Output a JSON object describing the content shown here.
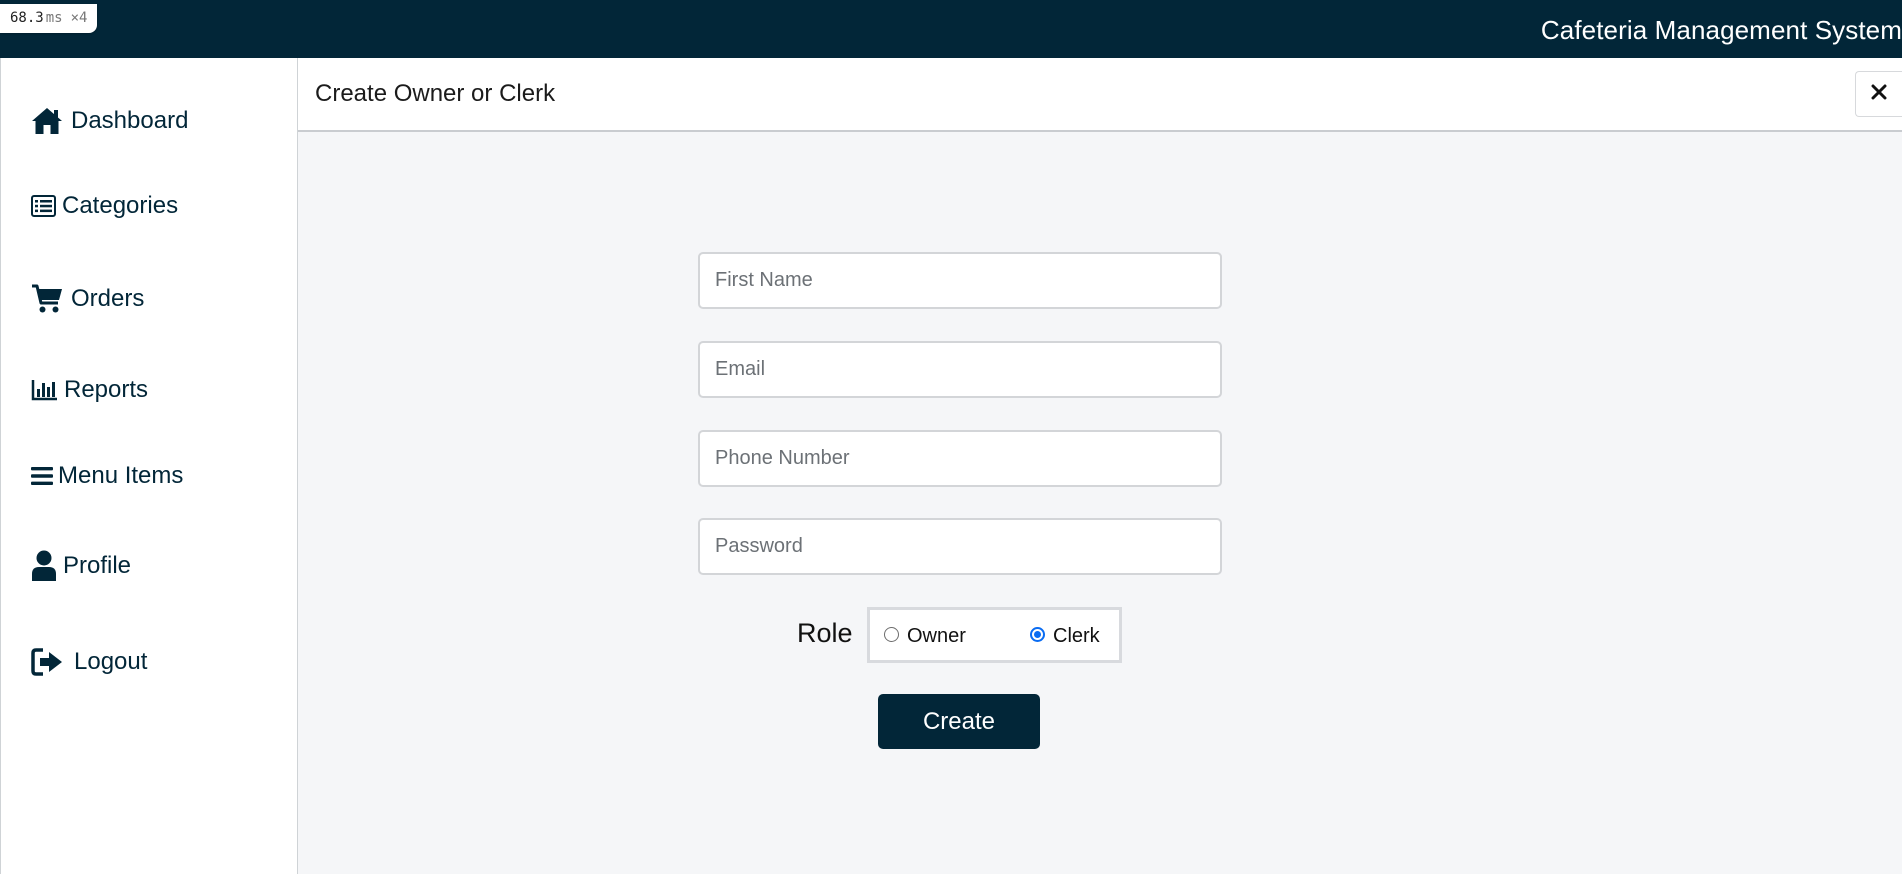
{
  "perf": {
    "value": "68.3",
    "unit": "ms",
    "multiplier": "×4"
  },
  "header": {
    "app_title": "Cafeteria Management System"
  },
  "sidebar": {
    "items": [
      {
        "label": "Dashboard",
        "icon": "home-icon"
      },
      {
        "label": "Categories",
        "icon": "list-alt-icon"
      },
      {
        "label": "Orders",
        "icon": "shopping-cart-icon"
      },
      {
        "label": "Reports",
        "icon": "bar-chart-icon"
      },
      {
        "label": "Menu Items",
        "icon": "bars-icon"
      },
      {
        "label": "Profile",
        "icon": "user-icon"
      },
      {
        "label": "Logout",
        "icon": "sign-out-icon"
      }
    ]
  },
  "modal": {
    "title": "Create Owner or Clerk",
    "close_icon": "close-icon",
    "form": {
      "first_name_placeholder": "First Name",
      "email_placeholder": "Email",
      "phone_placeholder": "Phone Number",
      "password_placeholder": "Password",
      "role_label": "Role",
      "role_options": [
        "Owner",
        "Clerk"
      ],
      "role_selected": "Clerk",
      "submit_label": "Create"
    }
  },
  "colors": {
    "primary": "#022638",
    "background": "#f5f6f8",
    "radio_accent": "#0a6cf2"
  }
}
